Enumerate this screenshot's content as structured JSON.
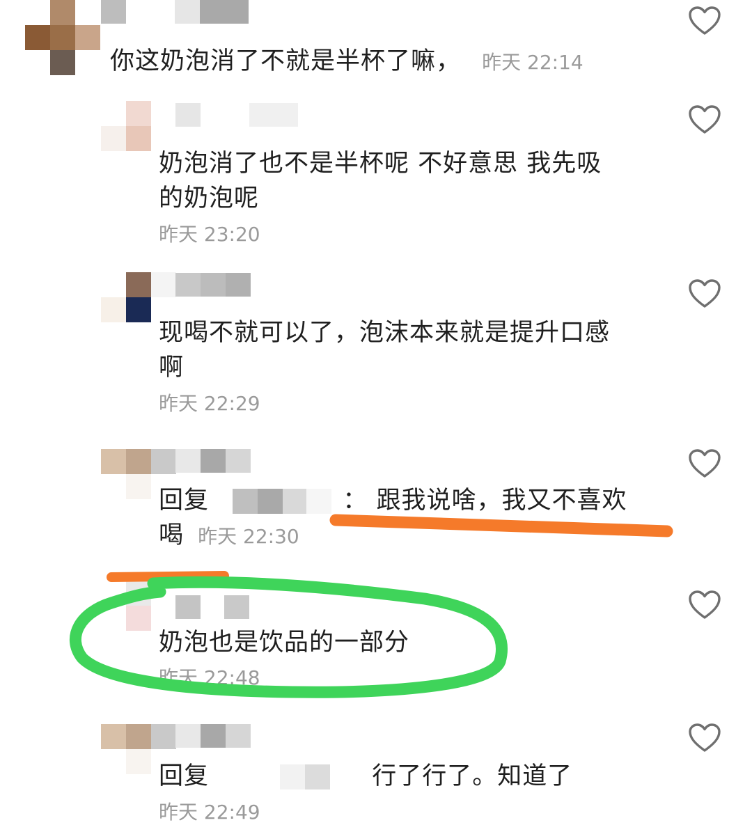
{
  "comments": [
    {
      "text": "你这奶泡消了不就是半杯了嘛，",
      "time": "昨天 22:14"
    },
    {
      "text_line1": "奶泡消了也不是半杯呢 不好意思 我先吸",
      "text_line2": "的奶泡呢",
      "time": "昨天 23:20"
    },
    {
      "text_line1": "现喝不就可以了，泡沫本来就是提升口感",
      "text_line2": "啊",
      "time": "昨天 22:29"
    },
    {
      "reply_prefix": "回复",
      "colon": "：",
      "text_line1": "跟我说啥，我又不喜欢",
      "text_line2": "喝",
      "time": "昨天 22:30"
    },
    {
      "text": "奶泡也是饮品的一部分",
      "time": "昨天 22:48"
    },
    {
      "reply_prefix": "回复",
      "text": "行了行了。知道了",
      "time": "昨天 22:49"
    }
  ],
  "icons": {
    "like": "heart-outline-icon"
  },
  "colors": {
    "annotation_underline": "#f57a2a",
    "annotation_circle": "#3fd45a",
    "timestamp": "#9a9a9a",
    "text": "#1f1f1f"
  }
}
